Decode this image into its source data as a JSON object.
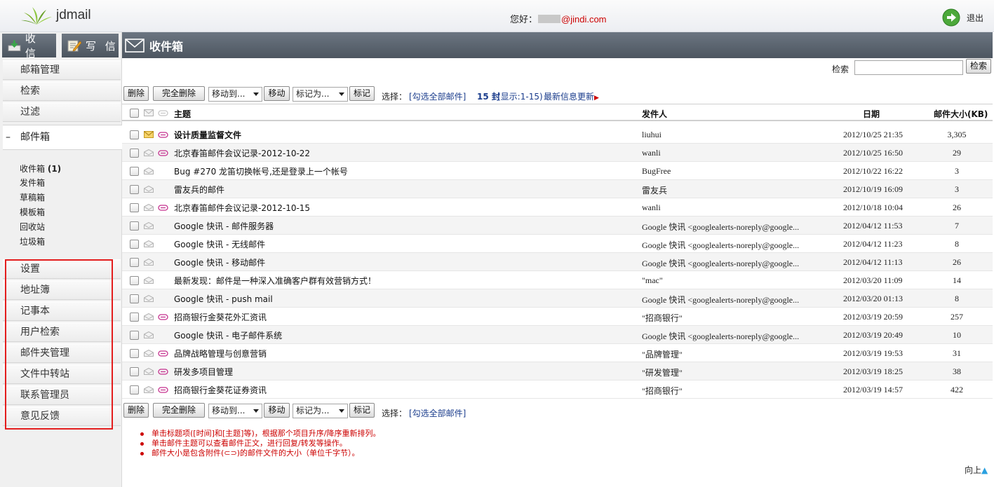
{
  "header": {
    "logo_text": "jdmail",
    "greeting_label": "您好：",
    "user_email_domain": "@jindi.com",
    "logout_label": "退出"
  },
  "sidebar": {
    "receive_label": "收 信",
    "compose_label": "写 信",
    "top_items": [
      "邮箱管理",
      "检索",
      "过滤"
    ],
    "mailbox_label": "邮件箱",
    "folders": [
      {
        "name": "收件箱",
        "count": "(1)"
      },
      {
        "name": "发件箱"
      },
      {
        "name": "草稿箱"
      },
      {
        "name": "模板箱"
      },
      {
        "name": "回收站"
      },
      {
        "name": "垃圾箱"
      }
    ],
    "bottom_items": [
      "设置",
      "地址簿",
      "记事本",
      "用户检索",
      "邮件夹管理",
      "文件中转站",
      "联系管理员",
      "意见反馈"
    ]
  },
  "main": {
    "title": "收件箱",
    "search_label": "检索",
    "search_button": "检索",
    "toolbar": {
      "delete": "删除",
      "delete_all": "完全删除",
      "move_to": "移动到...",
      "move": "移动",
      "mark_as": "标记为...",
      "mark": "标记",
      "select_label": "选择：",
      "select_all": "[勾选全部邮件]",
      "count_bold": "15 封",
      "count_info": "(显示:1-15)",
      "refresh": "最新信息更新"
    },
    "columns": {
      "subject": "主题",
      "sender": "发件人",
      "date": "日期",
      "size": "邮件大小(KB)"
    },
    "emails": [
      {
        "subject": "设计质量监督文件",
        "sender": "liuhui",
        "date": "2012/10/25 21:35",
        "size": "3,305",
        "unread": true,
        "attach": true
      },
      {
        "subject": "北京春笛邮件会议记录-2012-10-22",
        "sender": "wanli",
        "date": "2012/10/25 16:50",
        "size": "29",
        "unread": false,
        "attach": true
      },
      {
        "subject": "Bug #270 龙笛切换帐号,还是登录上一个帐号",
        "sender": "BugFree",
        "date": "2012/10/22 16:22",
        "size": "3",
        "unread": false,
        "attach": false
      },
      {
        "subject": "雷友兵的邮件",
        "sender": "雷友兵",
        "date": "2012/10/19 16:09",
        "size": "3",
        "unread": false,
        "attach": false
      },
      {
        "subject": "北京春笛邮件会议记录-2012-10-15",
        "sender": "wanli",
        "date": "2012/10/18 10:04",
        "size": "26",
        "unread": false,
        "attach": true
      },
      {
        "subject": "Google 快讯 - 邮件服务器",
        "sender": "Google 快讯 <googlealerts-noreply@google...",
        "date": "2012/04/12 11:53",
        "size": "7",
        "unread": false,
        "attach": false
      },
      {
        "subject": "Google 快讯 - 无线邮件",
        "sender": "Google 快讯 <googlealerts-noreply@google...",
        "date": "2012/04/12 11:23",
        "size": "8",
        "unread": false,
        "attach": false
      },
      {
        "subject": "Google 快讯 - 移动邮件",
        "sender": "Google 快讯 <googlealerts-noreply@google...",
        "date": "2012/04/12 11:13",
        "size": "26",
        "unread": false,
        "attach": false
      },
      {
        "subject": "最新发现：邮件是一种深入准确客户群有效营销方式！",
        "sender": "\"mac\"",
        "date": "2012/03/20 11:09",
        "size": "14",
        "unread": false,
        "attach": false
      },
      {
        "subject": "Google 快讯 - push mail",
        "sender": "Google 快讯 <googlealerts-noreply@google...",
        "date": "2012/03/20 01:13",
        "size": "8",
        "unread": false,
        "attach": false
      },
      {
        "subject": "招商银行金葵花外汇资讯",
        "sender": "\"招商银行\"",
        "date": "2012/03/19 20:59",
        "size": "257",
        "unread": false,
        "attach": true
      },
      {
        "subject": "Google 快讯 - 电子邮件系统",
        "sender": "Google 快讯 <googlealerts-noreply@google...",
        "date": "2012/03/19 20:49",
        "size": "10",
        "unread": false,
        "attach": false
      },
      {
        "subject": "品牌战略管理与创意营销",
        "sender": "\"品牌管理\"",
        "date": "2012/03/19 19:53",
        "size": "31",
        "unread": false,
        "attach": true
      },
      {
        "subject": "研发多项目管理",
        "sender": "\"研发管理\"",
        "date": "2012/03/19 18:25",
        "size": "38",
        "unread": false,
        "attach": true
      },
      {
        "subject": "招商银行金葵花证券资讯",
        "sender": "\"招商银行\"",
        "date": "2012/03/19 14:57",
        "size": "422",
        "unread": false,
        "attach": true
      }
    ],
    "notes": [
      "单击标题项([时间]和[主题]等)，根据那个项目升序/降序重新排列。",
      "单击邮件主题可以查看邮件正文，进行回复/转发等操作。",
      "邮件大小是包含附件(⊂⊃)的邮件文件的大小（单位千字节）。"
    ],
    "to_top": "向上"
  },
  "colors": {
    "titlebar": "#5b6470",
    "highlight_box": "#e31d1d",
    "notes": "#cc0000",
    "link": "#1a3c8c"
  }
}
